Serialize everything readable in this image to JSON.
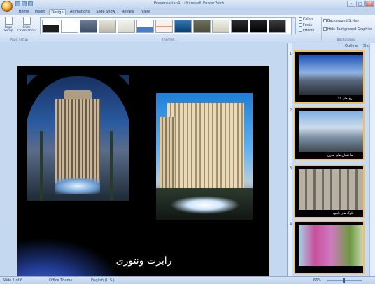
{
  "window": {
    "title": "Presentation1 - Microsoft PowerPoint"
  },
  "tabs": [
    "Home",
    "Insert",
    "Design",
    "Animations",
    "Slide Show",
    "Review",
    "View"
  ],
  "active_tab": "Design",
  "ribbon": {
    "page_setup": {
      "page_setup_label": "Page Setup",
      "orientation_label": "Slide Orientation",
      "group_label": "Page Setup"
    },
    "themes": {
      "group_label": "Themes"
    },
    "theme_options": {
      "colors_label": "Colors",
      "fonts_label": "Fonts",
      "effects_label": "Effects"
    },
    "background": {
      "styles_label": "Background Styles",
      "hide_label": "Hide Background Graphics",
      "group_label": "Background"
    }
  },
  "pane": {
    "outline_tab": "Outline",
    "slides_tab": "Slides"
  },
  "slide": {
    "caption": "رابرت ونتوری"
  },
  "thumbnails": [
    {
      "num": "1",
      "caption": "برج های بالا"
    },
    {
      "num": "2",
      "caption": "ساختمان های مدرن"
    },
    {
      "num": "3",
      "caption": "بلوک های یادبود"
    },
    {
      "num": "4",
      "caption": ""
    }
  ],
  "status": {
    "slide_info": "Slide 1 of 6",
    "theme": "Office Theme",
    "language": "English (U.S.)",
    "zoom": "66%"
  },
  "colors": {
    "accent": "#f3c15a",
    "ribbon": "#d9e6f6",
    "slide_bg": "#000000"
  }
}
